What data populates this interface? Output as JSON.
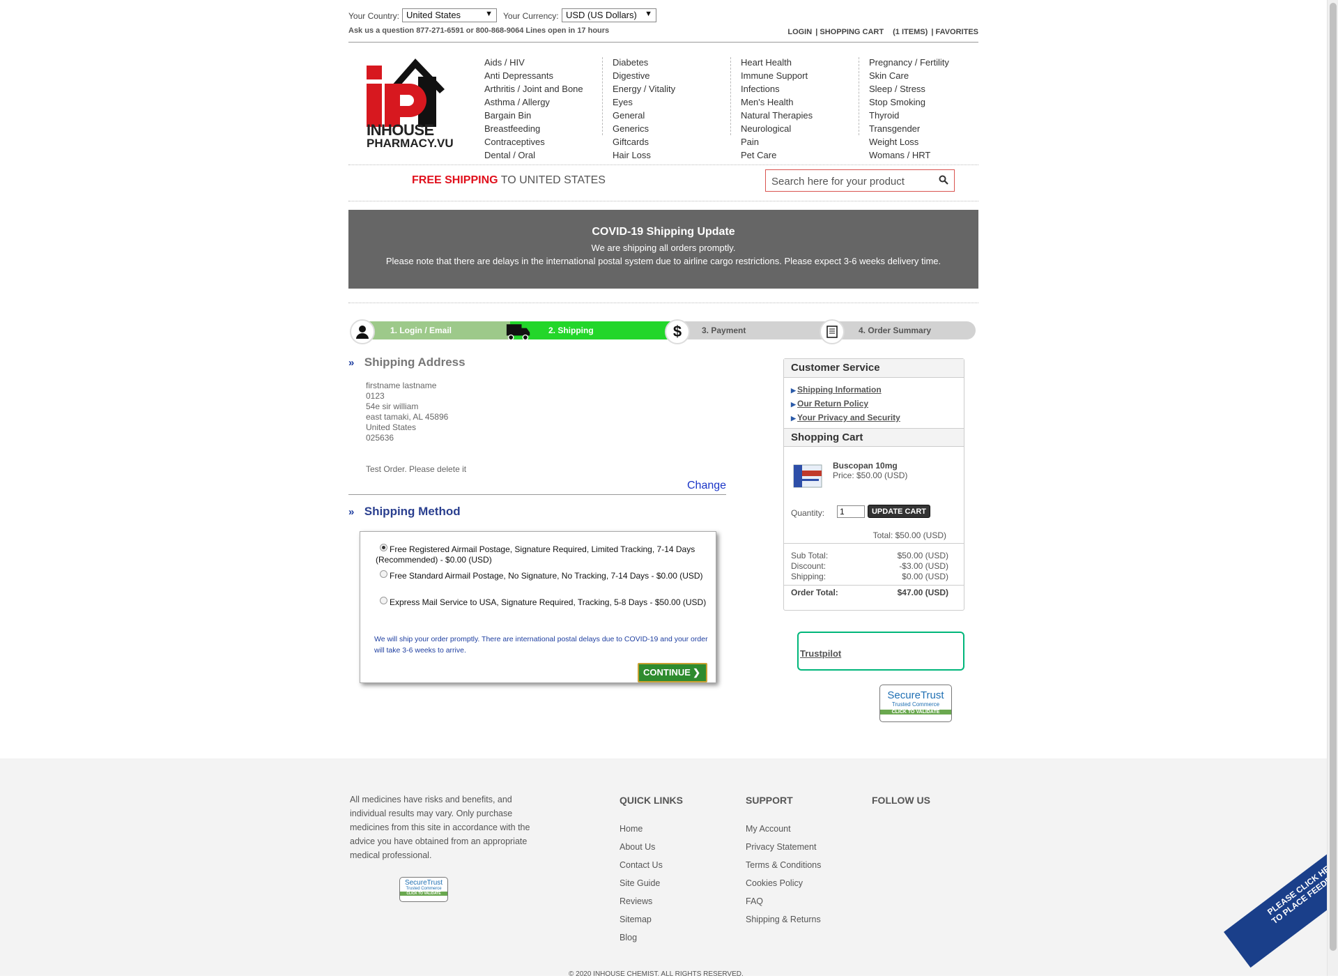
{
  "topbar": {
    "country_label": "Your Country:",
    "country_value": "United States",
    "currency_label": "Your Currency:",
    "currency_value": "USD (US Dollars)",
    "ask": "Ask us a question 877-271-6591 or 800-868-9064  Lines open in 17 hours",
    "login": "LOGIN",
    "cart": "SHOPPING CART",
    "items": "(1 ITEMS)",
    "favorites": "FAVORITES"
  },
  "logo": {
    "line1": "INHOUSE",
    "line2": "PHARMACY.VU"
  },
  "categories": [
    [
      "Aids / HIV",
      "Anti Depressants",
      "Arthritis / Joint and Bone",
      "Asthma / Allergy",
      "Bargain Bin",
      "Breastfeeding",
      "Contraceptives",
      "Dental / Oral"
    ],
    [
      "Diabetes",
      "Digestive",
      "Energy / Vitality",
      "Eyes",
      "General",
      "Generics",
      "Giftcards",
      "Hair Loss"
    ],
    [
      "Heart Health",
      "Immune Support",
      "Infections",
      "Men's Health",
      "Natural Therapies",
      "Neurological",
      "Pain",
      "Pet Care"
    ],
    [
      "Pregnancy / Fertility",
      "Skin Care",
      "Sleep / Stress",
      "Stop Smoking",
      "Thyroid",
      "Transgender",
      "Weight Loss",
      "Womans / HRT"
    ]
  ],
  "freeship": {
    "bold": "FREE SHIPPING",
    "rest": " TO UNITED STATES"
  },
  "search": {
    "placeholder": "Search here for your product"
  },
  "covid": {
    "title": "COVID-19 Shipping Update",
    "line1": "We are shipping all orders promptly.",
    "line2": "Please note that there are delays in the international postal system due to airline cargo restrictions. Please expect 3-6 weeks delivery time."
  },
  "steps": [
    "1. Login / Email",
    "2. Shipping",
    "3. Payment",
    "4. Order Summary"
  ],
  "shipping_address": {
    "title": "Shipping Address",
    "lines": [
      "firstname lastname",
      "0123",
      "54e sir william",
      "east tamaki, AL 45896",
      "United States",
      "025636"
    ],
    "note": "Test Order. Please delete it",
    "change": "Change"
  },
  "shipping_method": {
    "title": "Shipping Method",
    "options": [
      "Free Registered Airmail Postage, Signature Required, Limited Tracking, 7-14 Days (Recommended) - $0.00 (USD)",
      "Free Standard Airmail Postage, No Signature, No Tracking, 7-14 Days - $0.00 (USD)",
      "Express Mail Service to USA, Signature Required, Tracking, 5-8 Days - $50.00 (USD)"
    ],
    "note": "We will ship your order promptly. There are international postal delays due to COVID-19 and your order will take 3-6 weeks to arrive.",
    "continue": "CONTINUE"
  },
  "customer_service": {
    "title": "Customer Service",
    "links": [
      "Shipping Information",
      "Our Return Policy",
      "Your Privacy and Security"
    ]
  },
  "cart": {
    "title": "Shopping Cart",
    "product": "Buscopan 10mg",
    "price": "Price: $50.00 (USD)",
    "qty_label": "Quantity:",
    "qty": "1",
    "update": "UPDATE CART",
    "total": "Total: $50.00 (USD)",
    "summary": [
      {
        "label": "Sub Total:",
        "value": "$50.00 (USD)"
      },
      {
        "label": "Discount:",
        "value": "-$3.00 (USD)"
      },
      {
        "label": "Shipping:",
        "value": "$0.00 (USD)"
      }
    ],
    "order_total_label": "Order Total:",
    "order_total_value": "$47.00 (USD)"
  },
  "trustpilot": "Trustpilot",
  "seal": {
    "line1": "SecureTrust",
    "line2": "Trusted Commerce",
    "line3": "CLICK TO VALIDATE"
  },
  "footer": {
    "disclaimer": "All medicines have risks and benefits, and individual results may vary. Only purchase medicines from this site in accordance with the advice you have obtained from an appropriate medical professional.",
    "quick_links_title": "QUICK LINKS",
    "quick_links": [
      "Home",
      "About Us",
      "Contact Us",
      "Site Guide",
      "Reviews",
      "Sitemap",
      "Blog"
    ],
    "support_title": "SUPPORT",
    "support_links": [
      "My Account",
      "Privacy Statement",
      "Terms & Conditions",
      "Cookies Policy",
      "FAQ",
      "Shipping & Returns"
    ],
    "follow_title": "FOLLOW US",
    "copyright": "© 2020 INHOUSE CHEMIST. ALL RIGHTS RESERVED."
  },
  "feedback": {
    "line1": "PLEASE CLICK HERE",
    "line2": "TO PLACE FEEDBACK"
  },
  "colors": {
    "free_ship_red": "#e0101c",
    "step_active": "#23d62a",
    "link_blue": "#1a35c7",
    "banner_gray": "#666666"
  }
}
